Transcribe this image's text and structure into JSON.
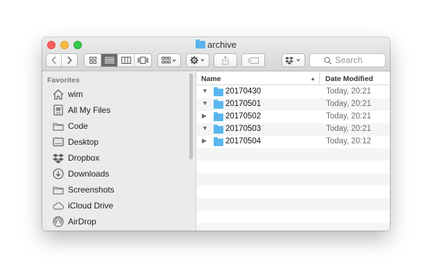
{
  "window": {
    "title": "archive"
  },
  "search": {
    "placeholder": "Search"
  },
  "sidebar": {
    "heading": "Favorites",
    "items": [
      {
        "label": "wim",
        "icon": "home-icon"
      },
      {
        "label": "All My Files",
        "icon": "all-files-icon"
      },
      {
        "label": "Code",
        "icon": "folder-icon"
      },
      {
        "label": "Desktop",
        "icon": "desktop-icon"
      },
      {
        "label": "Dropbox",
        "icon": "dropbox-icon"
      },
      {
        "label": "Downloads",
        "icon": "downloads-icon"
      },
      {
        "label": "Screenshots",
        "icon": "folder-icon"
      },
      {
        "label": "iCloud Drive",
        "icon": "cloud-icon"
      },
      {
        "label": "AirDrop",
        "icon": "airdrop-icon"
      }
    ]
  },
  "list": {
    "columns": {
      "name": "Name",
      "date": "Date Modified"
    },
    "rows": [
      {
        "name": "20170430",
        "date": "Today, 20:21",
        "expanded": true
      },
      {
        "name": "20170501",
        "date": "Today, 20:21",
        "expanded": true
      },
      {
        "name": "20170502",
        "date": "Today, 20:21",
        "expanded": false
      },
      {
        "name": "20170503",
        "date": "Today, 20:21",
        "expanded": true
      },
      {
        "name": "20170504",
        "date": "Today, 20:12",
        "expanded": false
      }
    ]
  },
  "colors": {
    "folder": "#5ab6ee",
    "close": "#fc605c",
    "minimize": "#fdbc40",
    "maximize": "#34c84a",
    "active_segment": "#6b6b6b"
  }
}
